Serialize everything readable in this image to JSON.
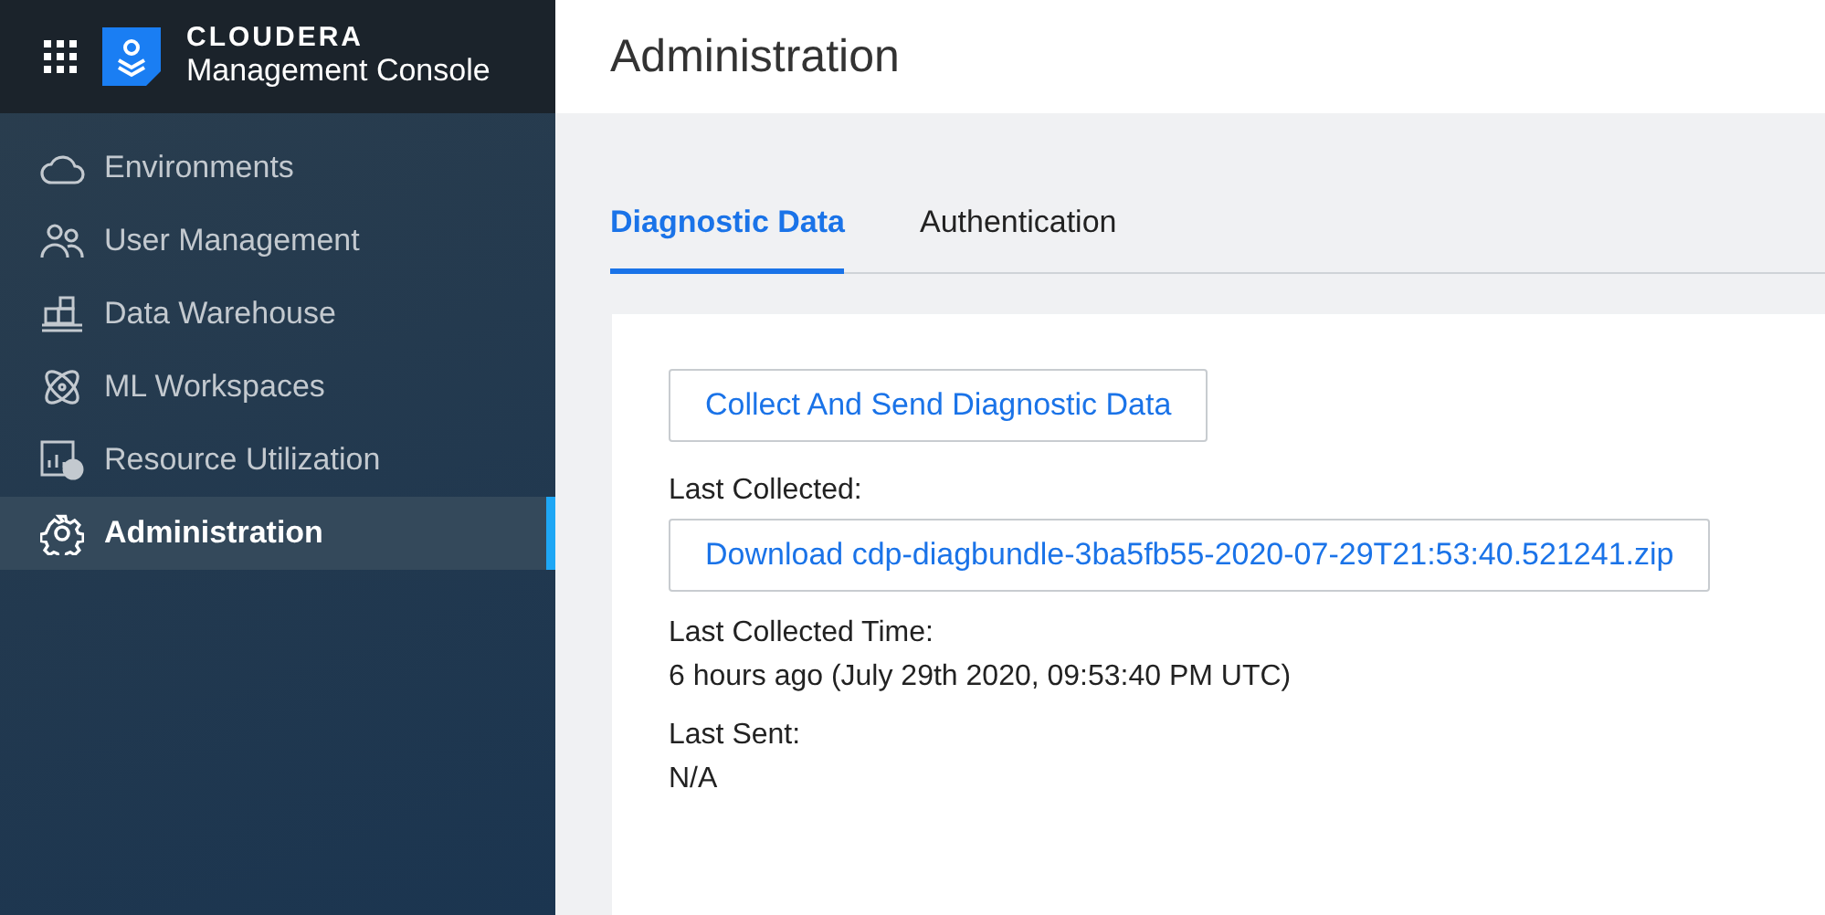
{
  "brand": {
    "name": "CLOUDERA",
    "product": "Management Console"
  },
  "sidebar": {
    "items": [
      {
        "label": "Environments",
        "selected": false
      },
      {
        "label": "User Management",
        "selected": false
      },
      {
        "label": "Data Warehouse",
        "selected": false
      },
      {
        "label": "ML Workspaces",
        "selected": false
      },
      {
        "label": "Resource Utilization",
        "selected": false
      },
      {
        "label": "Administration",
        "selected": true
      }
    ]
  },
  "page": {
    "title": "Administration"
  },
  "tabs": [
    {
      "label": "Diagnostic Data",
      "selected": true
    },
    {
      "label": "Authentication",
      "selected": false
    }
  ],
  "panel": {
    "collect_button": "Collect And Send Diagnostic Data",
    "fields": [
      {
        "label": "Last Collected:",
        "kind": "link",
        "value": "Download cdp-diagbundle-3ba5fb55-2020-07-29T21:53:40.521241.zip"
      },
      {
        "label": "Last Collected Time:",
        "kind": "text",
        "value": "6 hours ago (July 29th 2020, 09:53:40 PM UTC)"
      },
      {
        "label": "Last Sent:",
        "kind": "text",
        "value": "N/A"
      }
    ]
  }
}
